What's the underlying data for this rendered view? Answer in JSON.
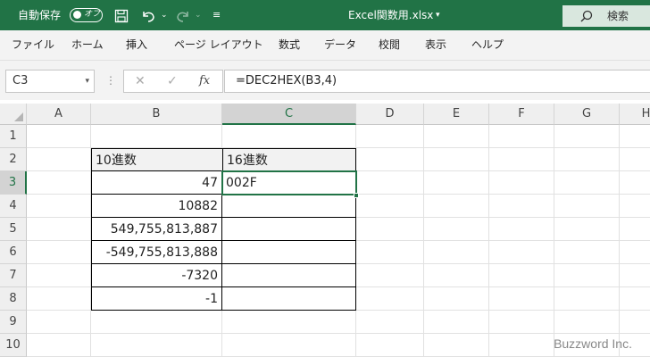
{
  "titlebar": {
    "autosave_label": "自動保存",
    "autosave_state": "オフ",
    "filename": "Excel関数用.xlsx",
    "search_label": "検索"
  },
  "menu": [
    "ファイル",
    "ホーム",
    "挿入",
    "ページ レイアウト",
    "数式",
    "データ",
    "校閲",
    "表示",
    "ヘルプ"
  ],
  "formula_bar": {
    "name_box": "C3",
    "fx": "fx",
    "formula": "=DEC2HEX(B3,4)"
  },
  "columns": [
    "A",
    "B",
    "C",
    "D",
    "E",
    "F",
    "G",
    "H"
  ],
  "rows": [
    "1",
    "2",
    "3",
    "4",
    "5",
    "6",
    "7",
    "8",
    "9",
    "10"
  ],
  "table": {
    "header_b": "10進数",
    "header_c": "16進数",
    "b_values": [
      "47",
      "10882",
      "549,755,813,887",
      "-549,755,813,888",
      "-7320",
      "-1"
    ],
    "c_values": [
      "002F",
      "",
      "",
      "",
      "",
      ""
    ]
  },
  "watermark": "Buzzword Inc.",
  "colors": {
    "accent": "#217346",
    "search_bg": "#d9e7de"
  },
  "icons": [
    "save-icon",
    "undo-icon",
    "redo-icon",
    "customize-icon",
    "dropdown-icon",
    "search-icon",
    "cancel-icon",
    "enter-icon",
    "fx-icon"
  ]
}
